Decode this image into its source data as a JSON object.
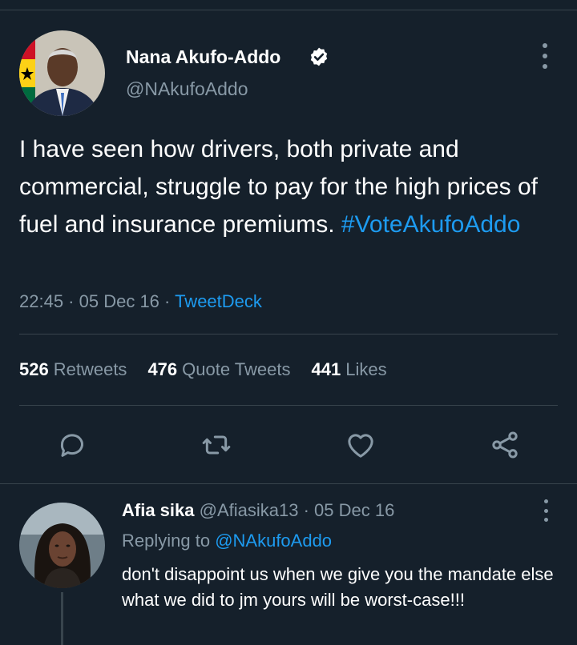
{
  "tweet": {
    "author": {
      "name": "Nana Akufo-Addo",
      "handle": "@NAkufoAddo",
      "verified": true
    },
    "text": "I have seen how drivers, both private and commercial, struggle to pay for the high prices of fuel and insurance premiums. ",
    "hashtag": "#VoteAkufoAddo",
    "time": "22:45",
    "date": "05 Dec 16",
    "separator": " · ",
    "source": "TweetDeck",
    "stats": {
      "retweets_count": "526",
      "retweets_label": "Retweets",
      "quotes_count": "476",
      "quotes_label": "Quote Tweets",
      "likes_count": "441",
      "likes_label": "Likes"
    },
    "actions": [
      "reply-icon",
      "retweet-icon",
      "like-icon",
      "share-icon"
    ]
  },
  "reply": {
    "name": "Afia sika",
    "handle": "@Afiasika13",
    "date": "05 Dec 16",
    "meta_separator": " · ",
    "replying_prefix": "Replying to ",
    "replying_to": "@NAkufoAddo",
    "text": "don't disappoint us when we give you the mandate else what we did to jm yours will be worst-case!!!"
  },
  "colors": {
    "background": "#15202b",
    "text": "#ffffff",
    "secondary": "#8899a6",
    "accent": "#1d9bf0",
    "divider": "#38444d"
  }
}
